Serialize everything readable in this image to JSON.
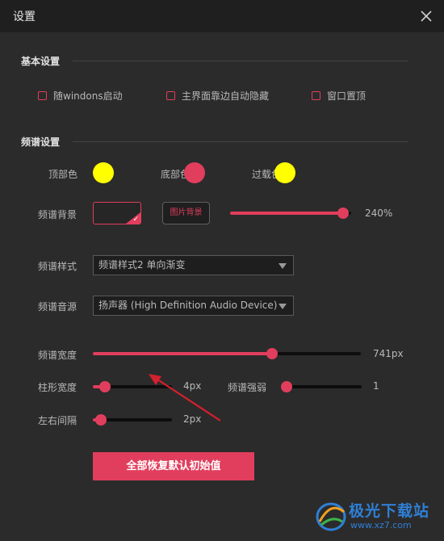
{
  "window": {
    "title": "设置"
  },
  "basic": {
    "section_title": "基本设置",
    "checkboxes": [
      {
        "label": "随windons启动",
        "checked": false
      },
      {
        "label": "主界面靠边自动隐藏",
        "checked": false
      },
      {
        "label": "窗口置顶",
        "checked": false
      }
    ]
  },
  "spectrum": {
    "section_title": "频谱设置",
    "colors": {
      "top_label": "顶部色",
      "top_color": "#ffff00",
      "bottom_label": "底部色",
      "bottom_color": "#e13e5d",
      "overload_label": "过载色",
      "overload_color": "#ffff00"
    },
    "background": {
      "label": "频谱背景",
      "image_button": "图片背景",
      "opacity_value": "240%",
      "opacity_fraction": 0.93
    },
    "style": {
      "label": "频谱样式",
      "value": "频谱样式2 单向渐变"
    },
    "source": {
      "label": "频谱音源",
      "value": "扬声器 (High Definition Audio Device)"
    },
    "width": {
      "label": "频谱宽度",
      "value": "741px",
      "fraction": 0.67
    },
    "bar_width": {
      "label": "柱形宽度",
      "value": "4px",
      "fraction": 0.15
    },
    "intensity": {
      "label": "频谱强弱",
      "value": "1",
      "fraction": 0.05
    },
    "spacing": {
      "label": "左右间隔",
      "value": "2px",
      "fraction": 0.1
    }
  },
  "reset_button": "全部恢复默认初始值",
  "watermark": {
    "brand": "极光下载站",
    "url": "www.xz7.com"
  },
  "accent_color": "#e13e5d"
}
